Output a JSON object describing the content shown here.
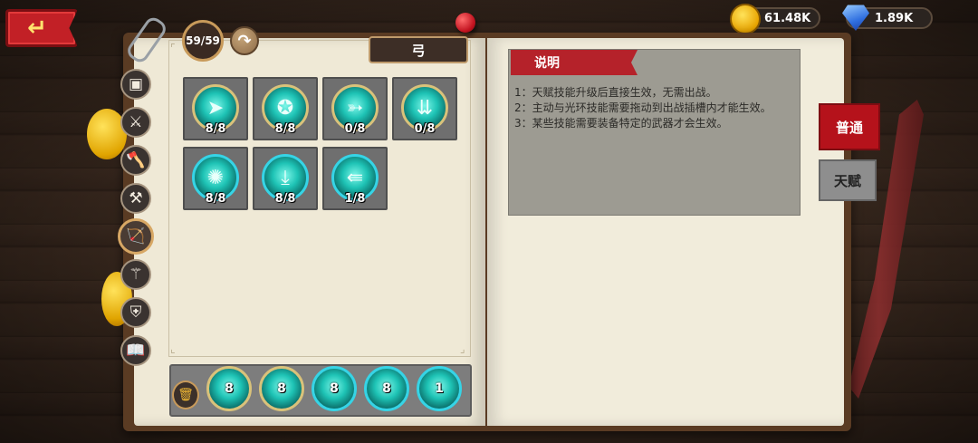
{
  "header": {
    "back_icon": "back-arrow-icon",
    "currencies": [
      {
        "name": "gold",
        "icon": "coin-icon",
        "value": "61.48K",
        "color": "#f2b933"
      },
      {
        "name": "gem",
        "icon": "diamond-icon",
        "value": "1.89K",
        "color": "#3a7bec"
      }
    ]
  },
  "book": {
    "page_count": "59/59",
    "next_icon": "curved-arrow-right-icon",
    "weapon_title": "弓",
    "side_tabs": [
      {
        "icon": "chest-icon",
        "glyph": "▣"
      },
      {
        "icon": "sword-icon",
        "glyph": "⚔"
      },
      {
        "icon": "axe-icon",
        "glyph": "🪓"
      },
      {
        "icon": "hammer-icon",
        "glyph": "⚒"
      },
      {
        "icon": "bow-icon",
        "glyph": "🏹",
        "active": true
      },
      {
        "icon": "staff-icon",
        "glyph": "⚚"
      },
      {
        "icon": "shield-icon",
        "glyph": "⛨"
      },
      {
        "icon": "book-icon",
        "glyph": "📖"
      }
    ],
    "skills": [
      {
        "icon": "boot-speed-icon",
        "glyph": "➤",
        "count": "8/8",
        "ring": "gold"
      },
      {
        "icon": "wolf-icon",
        "glyph": "✪",
        "count": "8/8",
        "ring": "gold"
      },
      {
        "icon": "piercing-arrow-icon",
        "glyph": "➳",
        "count": "0/8",
        "ring": "gold"
      },
      {
        "icon": "arrow-rain-icon",
        "glyph": "⇊",
        "count": "0/8",
        "ring": "gold"
      },
      {
        "icon": "arrow-burst-icon",
        "glyph": "✺",
        "count": "8/8",
        "ring": "cyan"
      },
      {
        "icon": "poison-arrow-icon",
        "glyph": "⤓",
        "count": "8/8",
        "ring": "cyan"
      },
      {
        "icon": "multi-arrow-icon",
        "glyph": "⇚",
        "count": "1/8",
        "ring": "cyan"
      }
    ],
    "equipped": [
      {
        "icon": "boot-speed-icon",
        "value": "8",
        "ring": "gold"
      },
      {
        "icon": "wolf-icon",
        "value": "8",
        "ring": "gold"
      },
      {
        "icon": "poison-arrow-icon",
        "value": "8",
        "ring": "cyan"
      },
      {
        "icon": "arrow-burst-icon",
        "value": "8",
        "ring": "cyan"
      },
      {
        "icon": "multi-arrow-icon",
        "value": "1",
        "ring": "cyan"
      }
    ],
    "trash_icon": "trash-icon"
  },
  "description": {
    "title": "说明",
    "lines": [
      "1：天赋技能升级后直接生效，无需出战。",
      "2：主动与光环技能需要拖动到出战插槽内才能生效。",
      "3：某些技能需要装备特定的武器才会生效。"
    ]
  },
  "right_tabs": {
    "normal": "普通",
    "talent": "天赋"
  },
  "colors": {
    "accent_red": "#b5121b",
    "skill_teal": "#1ec3b5",
    "page": "#efe9d6"
  }
}
